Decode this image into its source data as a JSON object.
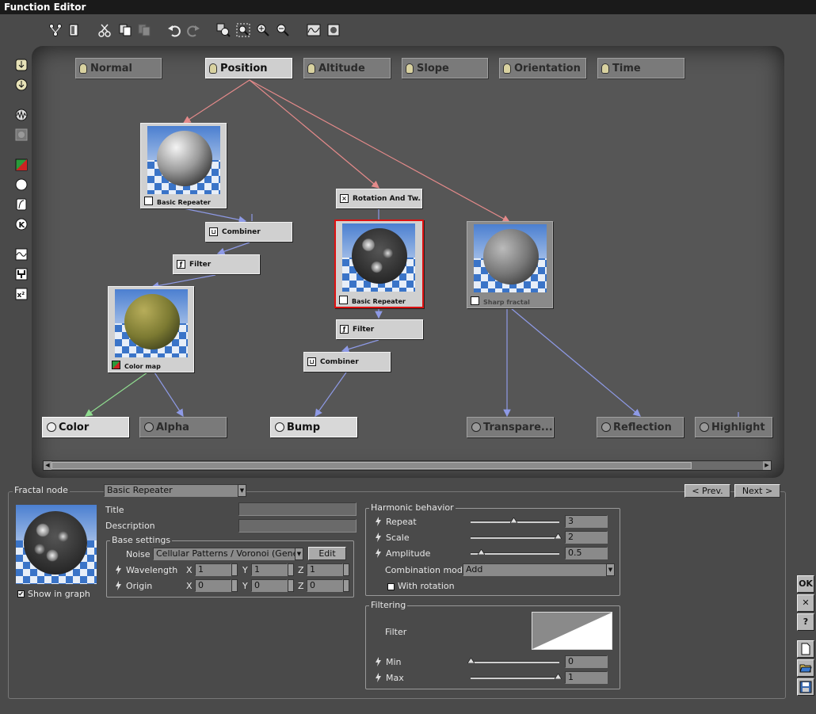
{
  "window": {
    "title": "Function Editor"
  },
  "toolbar": {
    "icons": [
      "graph-layout-icon",
      "clipboard-icon",
      "cut-icon",
      "copy-icon",
      "paste-icon",
      "undo-icon",
      "redo-icon",
      "zoom-fit-icon",
      "zoom-selection-icon",
      "zoom-in-icon",
      "zoom-out-icon",
      "curve-view-icon",
      "export-icon"
    ]
  },
  "sidebar": {
    "icons": [
      "input-node-icon",
      "output-node-icon",
      "noise-node-icon",
      "fractal-node-icon",
      "color-node-icon",
      "constant-node-icon",
      "filter-node-icon",
      "constant-k-icon",
      "wave-node-icon",
      "combiner-node-icon",
      "math-node-icon"
    ]
  },
  "graph": {
    "inputs": [
      "Normal",
      "Position",
      "Altitude",
      "Slope",
      "Orientation",
      "Time"
    ],
    "active_input": "Position",
    "outputs": [
      "Color",
      "Alpha",
      "Bump",
      "Transpare...",
      "Reflection",
      "Highlight"
    ],
    "nodes": {
      "basic_repeater_1": "Basic Repeater",
      "combiner_1": "Combiner",
      "filter_1": "Filter",
      "color_map": "Color map",
      "rotation": "Rotation And Tw...",
      "basic_repeater_2": "Basic Repeater",
      "filter_2": "Filter",
      "combiner_2": "Combiner",
      "sharp_fractal": "Sharp fractal"
    },
    "colors": {
      "link_red": "#e48a8a",
      "link_blue": "#8e9ae6",
      "link_green": "#8fdc8f",
      "selection": "#dd1111"
    }
  },
  "panel": {
    "node_type_label": "Fractal node",
    "node_type_value": "Basic Repeater",
    "prev_label": "< Prev.",
    "next_label": "Next >",
    "title_label": "Title",
    "title_value": "",
    "description_label": "Description",
    "description_value": "",
    "show_in_graph_label": "Show in graph",
    "base_settings": {
      "title": "Base settings",
      "noise_label": "Noise",
      "noise_value": "Cellular Patterns / Voronoi (Generaliz",
      "edit_label": "Edit",
      "wavelength_label": "Wavelength",
      "origin_label": "Origin",
      "axes": [
        "X",
        "Y",
        "Z"
      ],
      "wavelength": [
        "1",
        "1",
        "1"
      ],
      "origin": [
        "0",
        "0",
        "0"
      ]
    },
    "harmonic": {
      "title": "Harmonic behavior",
      "repeat_label": "Repeat",
      "repeat_value": "3",
      "repeat_level": 0.48,
      "scale_label": "Scale",
      "scale_value": "2",
      "scale_level": 0.98,
      "amplitude_label": "Amplitude",
      "amplitude_value": "0.5",
      "amplitude_level": 0.12,
      "combination_label": "Combination mode",
      "combination_value": "Add",
      "with_rotation_label": "With rotation"
    },
    "filtering": {
      "title": "Filtering",
      "filter_label": "Filter",
      "min_label": "Min",
      "min_value": "0",
      "min_level": 0.0,
      "max_label": "Max",
      "max_value": "1",
      "max_level": 0.98
    },
    "right_buttons": {
      "ok": "OK",
      "cancel": "✕",
      "help": "?"
    }
  }
}
